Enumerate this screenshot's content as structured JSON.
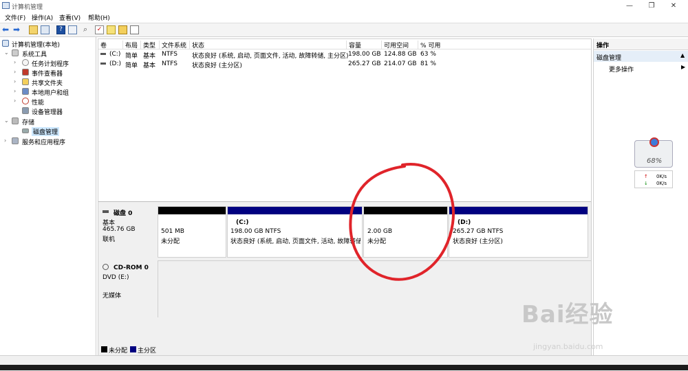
{
  "window": {
    "title": "计算机管理",
    "min": "—",
    "max": "❐",
    "close": "✕"
  },
  "menu": [
    "文件(F)",
    "操作(A)",
    "查看(V)",
    "帮助(H)"
  ],
  "tree": {
    "root": "计算机管理(本地)",
    "system_tools": "系统工具",
    "task_scheduler": "任务计划程序",
    "event_viewer": "事件查看器",
    "shared_folders": "共享文件夹",
    "local_users": "本地用户和组",
    "performance": "性能",
    "device_manager": "设备管理器",
    "storage": "存储",
    "disk_management": "磁盘管理",
    "services": "服务和应用程序"
  },
  "table": {
    "headers": [
      "卷",
      "布局",
      "类型",
      "文件系统",
      "状态",
      "容量",
      "可用空间",
      "% 可用"
    ],
    "rows": [
      {
        "vol": "(C:)",
        "layout": "简单",
        "type": "基本",
        "fs": "NTFS",
        "status": "状态良好 (系统, 启动, 页面文件, 活动, 故障转储, 主分区)",
        "capacity": "198.00 GB",
        "free": "124.88 GB",
        "pct": "63 %"
      },
      {
        "vol": "(D:)",
        "layout": "简单",
        "type": "基本",
        "fs": "NTFS",
        "status": "状态良好 (主分区)",
        "capacity": "265.27 GB",
        "free": "214.07 GB",
        "pct": "81 %"
      }
    ]
  },
  "disk0": {
    "name": "磁盘 0",
    "type": "基本",
    "size": "465.76 GB",
    "state": "联机",
    "partitions": [
      {
        "size": "501 MB",
        "status": "未分配"
      },
      {
        "letter": "(C:)",
        "size": "198.00 GB NTFS",
        "status": "状态良好 (系统, 启动, 页面文件, 活动, 故障转储,"
      },
      {
        "size": "2.00 GB",
        "status": "未分配"
      },
      {
        "letter": "(D:)",
        "size": "265.27 GB NTFS",
        "status": "状态良好 (主分区)"
      }
    ]
  },
  "cdrom": {
    "name": "CD-ROM 0",
    "type": "DVD (E:)",
    "state": "无媒体"
  },
  "legend": {
    "unallocated": "未分配",
    "primary": "主分区"
  },
  "actions": {
    "header": "操作",
    "section": "磁盘管理",
    "more": "更多操作"
  },
  "widget": {
    "percent": "68%",
    "up": "0K/s",
    "down": "0K/s"
  },
  "watermark": {
    "brand": "Bai经验",
    "url": "jingyan.baidu.com"
  },
  "colors": {
    "unallocated": "#000000",
    "primary": "#000080",
    "annotation": "#e0242a"
  }
}
